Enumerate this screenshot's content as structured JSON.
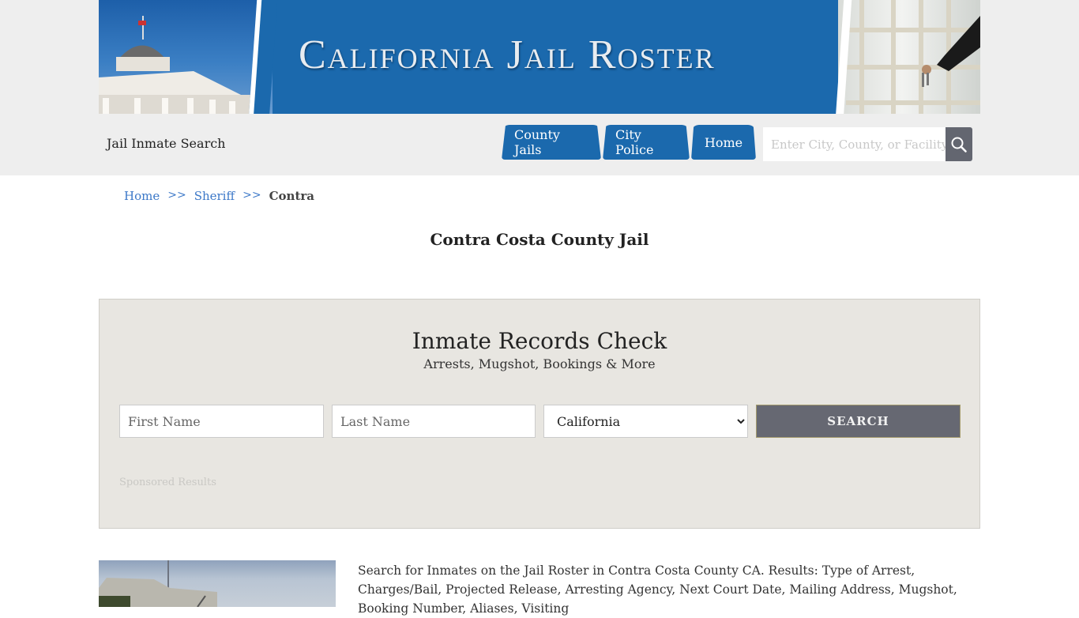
{
  "banner": {
    "title": "California Jail Roster"
  },
  "header": {
    "site_name": "Jail Inmate Search",
    "nav": [
      {
        "label": "County Jails"
      },
      {
        "label": "City Police"
      },
      {
        "label": "Home"
      }
    ],
    "search": {
      "placeholder": "Enter City, County, or Facility",
      "icon": "search-icon"
    }
  },
  "breadcrumb": {
    "items": [
      {
        "label": "Home"
      },
      {
        "label": "Sheriff"
      }
    ],
    "separator": ">>",
    "current": "Contra"
  },
  "page": {
    "title": "Contra Costa County Jail"
  },
  "records_check": {
    "title": "Inmate Records Check",
    "subtitle": "Arrests, Mugshot, Bookings & More",
    "first_name_placeholder": "First Name",
    "last_name_placeholder": "Last Name",
    "state_selected": "California",
    "search_label": "SEARCH",
    "sponsored_label": "Sponsored Results"
  },
  "description": {
    "text": "Search for Inmates on the Jail Roster in Contra Costa County CA. Results: Type of Arrest, Charges/Bail, Projected Release, Arresting Agency, Next Court Date, Mailing Address, Mugshot, Booking Number, Aliases, Visiting"
  },
  "colors": {
    "brand_blue": "#1b69ad",
    "link_blue": "#3c78c8",
    "button_gray": "#666872",
    "panel_bg": "#e8e6e1"
  }
}
